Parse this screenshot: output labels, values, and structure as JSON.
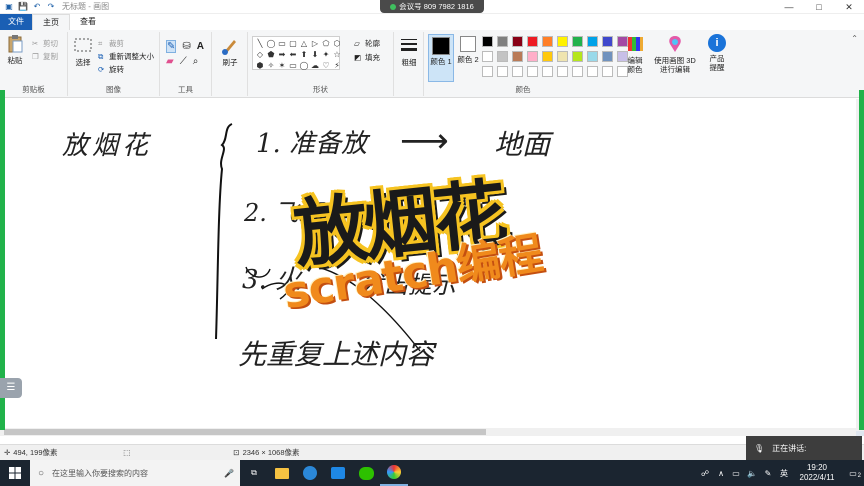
{
  "titlebar": {
    "title": "无标题 - 画图"
  },
  "meeting": {
    "label": "会议号 809 7982 1816"
  },
  "window_controls": {
    "minimize": "—",
    "maximize": "□",
    "close": "✕"
  },
  "tabs": {
    "file": "文件",
    "home": "主页",
    "view": "查看"
  },
  "ribbon": {
    "clipboard": {
      "group": "剪贴板",
      "paste": "粘贴",
      "cut": "剪切",
      "copy": "复制"
    },
    "image": {
      "group": "图像",
      "select": "选择",
      "crop": "裁剪",
      "resize": "重新调整大小",
      "rotate": "旋转"
    },
    "tools": {
      "group": "工具"
    },
    "brushes": {
      "label": "刷子"
    },
    "shapes": {
      "group": "形状",
      "outline": "轮廓",
      "fill": "填充",
      "glyphs": [
        "╲",
        "◯",
        "▭",
        "▢",
        "△",
        "▷",
        "⬠",
        "⬡",
        "◇",
        "⬟",
        "➡",
        "⬅",
        "⬆",
        "⬇",
        "✦",
        "☆",
        "⬢",
        "✧",
        "✶",
        "▭",
        "◯",
        "☁",
        "♡",
        "⚡"
      ]
    },
    "size": {
      "label": "粗细"
    },
    "color1": {
      "label": "颜色 1"
    },
    "color2": {
      "label": "颜色 2"
    },
    "colors": {
      "group": "颜色",
      "edit": "编辑颜色",
      "swatches": [
        "#000000",
        "#7f7f7f",
        "#880015",
        "#ed1c24",
        "#ff7f27",
        "#fff200",
        "#22b14c",
        "#00a2e8",
        "#3f48cc",
        "#a349a4",
        "#ffffff",
        "#c3c3c3",
        "#b97a57",
        "#ffaec9",
        "#ffc90e",
        "#efe4b0",
        "#b5e61d",
        "#99d9ea",
        "#7092be",
        "#c8bfe7",
        "#ffffff",
        "#ffffff",
        "#ffffff",
        "#ffffff",
        "#ffffff",
        "#ffffff",
        "#ffffff",
        "#ffffff",
        "#ffffff",
        "#ffffff"
      ]
    },
    "paint3d": {
      "label": "使用画图 3D 进行编辑"
    },
    "product": {
      "label": "产品提醒"
    }
  },
  "canvas": {
    "handwriting": {
      "title": "放烟花",
      "step1": "1. 准备放",
      "arrow": "⟶",
      "step1b": "地面",
      "step2": "2. 飞行",
      "step3": "3. 火",
      "step3b": "发出提示",
      "repeat": "先重复上述内容"
    },
    "overlay_title": "放烟花",
    "overlay_sub": "scratch编程"
  },
  "status": {
    "cursor": "494, 199像素",
    "size": "2346 × 1068像素"
  },
  "speaking": {
    "label": "正在讲话:"
  },
  "taskbar": {
    "search_placeholder": "在这里输入你要搜索的内容",
    "lang": "英",
    "time": "19:20",
    "date": "2022/4/11",
    "notify": "2"
  }
}
